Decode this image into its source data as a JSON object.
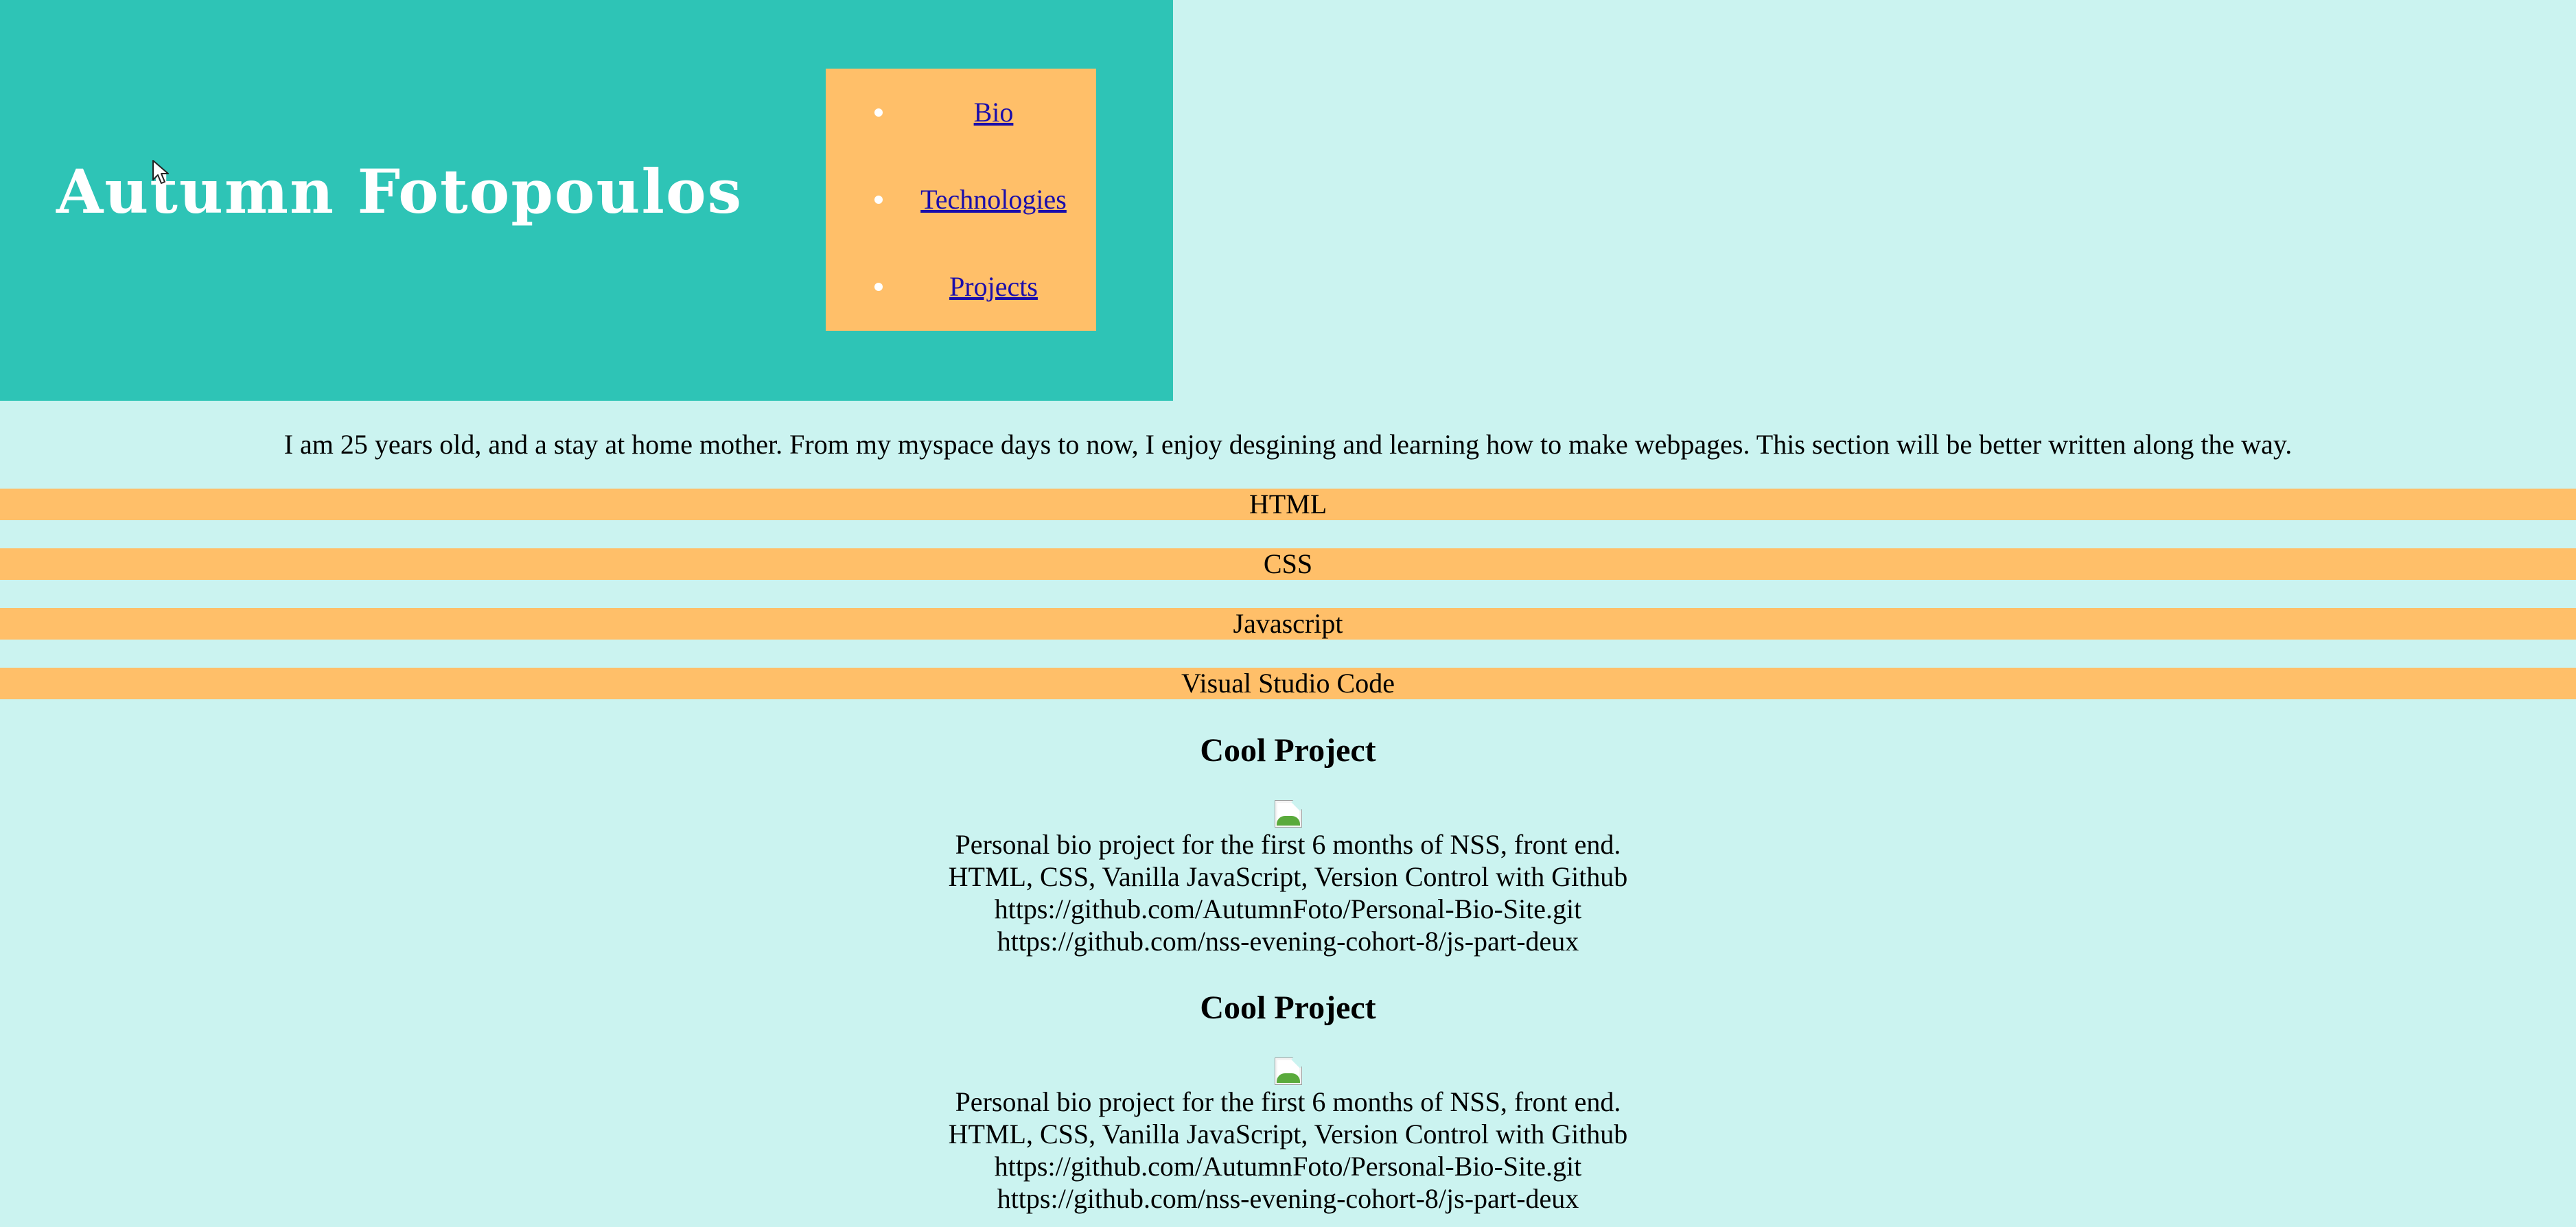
{
  "header": {
    "site_title": "Autumn Fotopoulos",
    "nav": {
      "items": [
        {
          "label": "Bio"
        },
        {
          "label": "Technologies"
        },
        {
          "label": "Projects"
        }
      ]
    }
  },
  "bio": {
    "text": "I am 25 years old, and a stay at home mother. From my myspace days to now, I enjoy desgining and learning how to make webpages. This section will be better written along the way."
  },
  "technologies": {
    "items": [
      {
        "label": "HTML"
      },
      {
        "label": "CSS"
      },
      {
        "label": "Javascript"
      },
      {
        "label": "Visual Studio Code"
      }
    ]
  },
  "projects": {
    "items": [
      {
        "title": "Cool Project",
        "description": "Personal bio project for the first 6 months of NSS, front end.",
        "tech": "HTML, CSS, Vanilla JavaScript, Version Control with Github",
        "link1": "https://github.com/AutumnFoto/Personal-Bio-Site.git",
        "link2": "https://github.com/nss-evening-cohort-8/js-part-deux"
      },
      {
        "title": "Cool Project",
        "description": "Personal bio project for the first 6 months of NSS, front end.",
        "tech": "HTML, CSS, Vanilla JavaScript, Version Control with Github",
        "link1": "https://github.com/AutumnFoto/Personal-Bio-Site.git",
        "link2": "https://github.com/nss-evening-cohort-8/js-part-deux"
      }
    ]
  },
  "icons": {
    "cursor": "mouse-pointer-icon",
    "project_image": "broken-image-icon"
  },
  "colors": {
    "page_background": "#cbf3f0",
    "header_background": "#2ec4b6",
    "accent": "#ffbf69",
    "title_text": "#ffffff",
    "link": "#1a0dab"
  }
}
